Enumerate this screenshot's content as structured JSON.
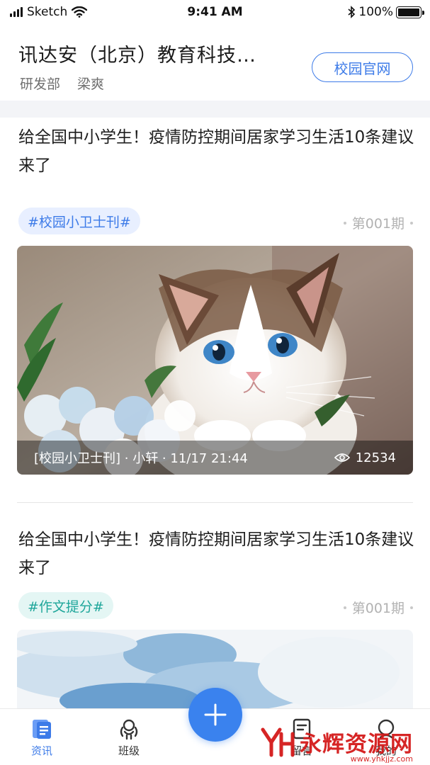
{
  "status_bar": {
    "carrier": "Sketch",
    "time": "9:41 AM",
    "battery": "100%"
  },
  "header": {
    "org_name": "讯达安（北京）教育科技…",
    "department": "研发部",
    "user_name": "梁爽",
    "site_button": "校园官网"
  },
  "feed": [
    {
      "title": "给全国中小学生！疫情防控期间居家学习生活10条建议来了",
      "tag": "#校园小卫士刊#",
      "issue": "第001期",
      "meta": "[校园小卫士刊] · 小轩 · 11/17 21:44",
      "views": "12534"
    },
    {
      "title": "给全国中小学生！疫情防控期间居家学习生活10条建议来了",
      "tag": "#作文提分#",
      "issue": "第001期"
    }
  ],
  "tabbar": {
    "tabs": [
      {
        "label": "资讯",
        "icon": "news-icon"
      },
      {
        "label": "班级",
        "icon": "class-icon"
      },
      {
        "label": "留言",
        "icon": "message-icon"
      },
      {
        "label": "我的",
        "icon": "profile-icon"
      }
    ],
    "fab_icon": "plus-icon",
    "watermark_text": "永辉资源网",
    "watermark_url": "www.yhkjjz.com"
  },
  "colors": {
    "accent": "#3d7be8",
    "teal": "#1ea69a",
    "watermark": "#d41a1a"
  }
}
